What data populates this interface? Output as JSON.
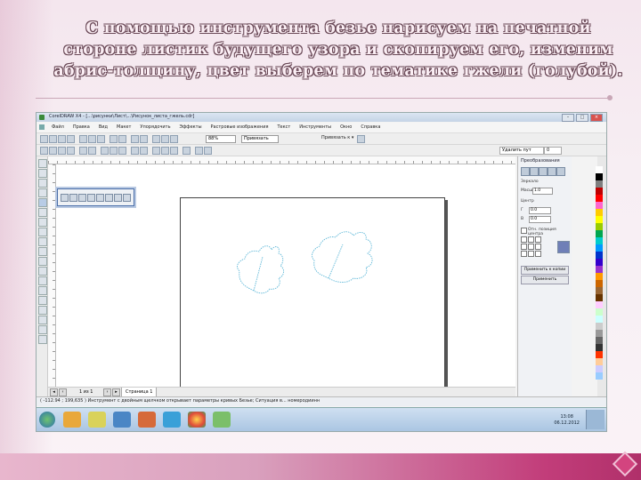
{
  "slide": {
    "title": "С помощью инструмента безье нарисуем на печатной стороне листик будущего узора и скопируем его, изменим абрис-толщину, цвет выберем по тематике гжели (голубой)."
  },
  "window": {
    "title": "CorelDRAW X4 - [...\\рисунки\\Лист\\...\\Рисунок_листа_гжель.cdr]",
    "buttons": {
      "minimize": "–",
      "maximize": "□",
      "close": "×"
    }
  },
  "menubar": {
    "items": [
      "Файл",
      "Правка",
      "Вид",
      "Макет",
      "Упорядочить",
      "Эффекты",
      "Растровые изображения",
      "Текст",
      "Инструменты",
      "Окно",
      "Справка"
    ]
  },
  "toolbar": {
    "zoom": "88%",
    "snap": "Привязать",
    "snap_menu": "Привязать к ▾"
  },
  "propertybar": {
    "field1": "Удалить пут",
    "field2": "0"
  },
  "canvas": {
    "page_label": "Страница 1",
    "page_counter": "1 из 1",
    "leaf_color": "#5fb8d8"
  },
  "docker": {
    "header": "Преобразования",
    "section_scale": "Зеркало",
    "label_width": "Масш",
    "width_value": "1.0",
    "section_pos": "Центр",
    "label_x": "Г",
    "x_value": "0.0",
    "label_y": "В",
    "y_value": "0.0",
    "checkbox_label": "Отн. позиция центра",
    "btn_apply_copy": "Применить к копии",
    "btn_apply": "Применить"
  },
  "palette": {
    "colors": [
      "#ffffff",
      "#000000",
      "#7f7f7f",
      "#c00000",
      "#ff0000",
      "#ff66cc",
      "#ffcc00",
      "#ffff00",
      "#99cc00",
      "#00a651",
      "#00cccc",
      "#0099ff",
      "#0033cc",
      "#3300cc",
      "#9933cc",
      "#ff9900",
      "#cc6600",
      "#996633",
      "#663300",
      "#ffccff",
      "#ccffcc",
      "#ccffff",
      "#cccccc",
      "#999999",
      "#666666",
      "#333333",
      "#ff3300",
      "#ffcc99",
      "#ccccff",
      "#99ccff"
    ]
  },
  "statusbar": {
    "text": "( -112.94 ; 199,635 )  Инструмент с двойным щелчком открывает параметры кривых Безье; Ситуация в...  номеродиинн"
  },
  "taskbar": {
    "time": "13:08",
    "date": "06.12.2012"
  }
}
